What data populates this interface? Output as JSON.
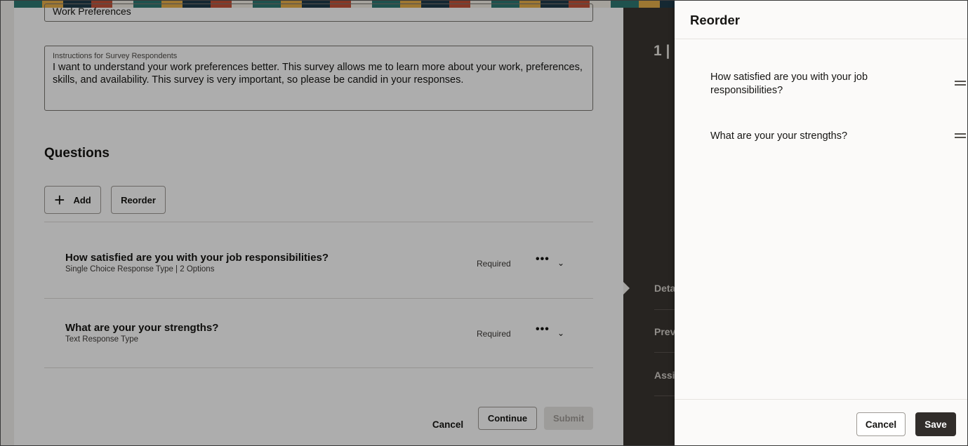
{
  "survey": {
    "title_value": "Work Preferences",
    "instructions_label": "Instructions for Survey Respondents",
    "instructions_value": "I want to understand your work preferences better. This survey allows me to learn more about your work, preferences, skills, and availability. This survey is very important, so please be candid in your responses."
  },
  "questions_section": {
    "heading": "Questions",
    "add_label": "Add",
    "reorder_label": "Reorder",
    "items": [
      {
        "title": "How satisfied are you with your job responsibilities?",
        "subtitle": "Single Choice Response Type | 2 Options",
        "status": "Required"
      },
      {
        "title": "What are your your strengths?",
        "subtitle": "Text Response Type",
        "status": "Required"
      }
    ]
  },
  "footer": {
    "cancel_label": "Cancel",
    "continue_label": "Continue",
    "submit_label": "Submit"
  },
  "side_nav": {
    "step_text": "1 |",
    "items": [
      "Details",
      "Preview",
      "Assign"
    ]
  },
  "drawer": {
    "title": "Reorder",
    "items": [
      "How satisfied are you with your job responsibilities?",
      "What are your your strengths?"
    ],
    "cancel_label": "Cancel",
    "save_label": "Save"
  },
  "colors": {
    "save_button_bg": "#312d2a",
    "overlay": "rgba(0,0,0,0.32)",
    "side_panel": "#3a3632"
  }
}
